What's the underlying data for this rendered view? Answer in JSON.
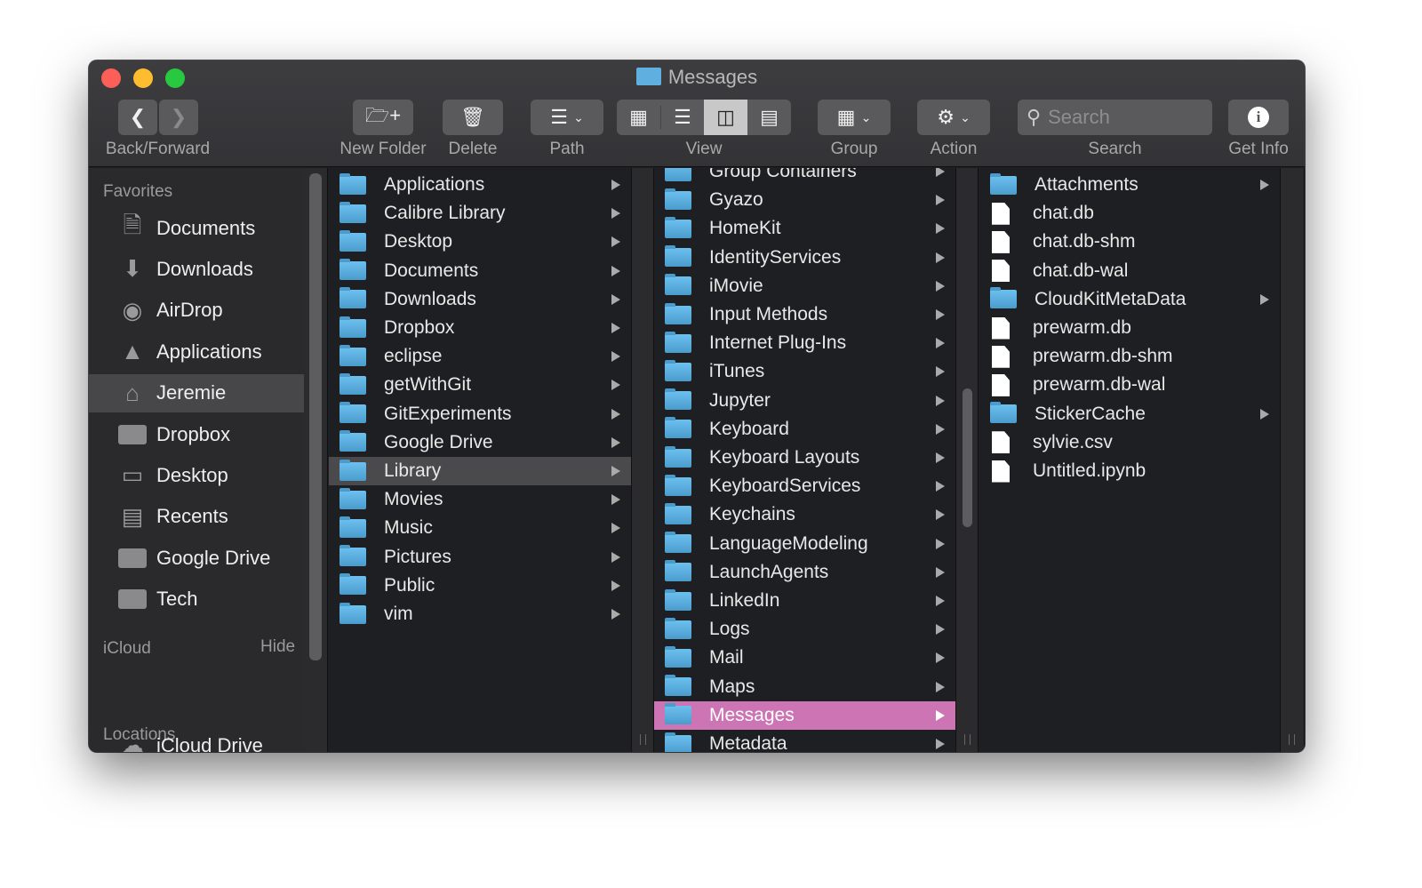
{
  "window": {
    "title": "Messages"
  },
  "toolbar": {
    "back_forward": "Back/Forward",
    "new_folder": "New Folder",
    "delete": "Delete",
    "path": "Path",
    "view": "View",
    "group": "Group",
    "action": "Action",
    "search_label": "Search",
    "search_placeholder": "Search",
    "get_info": "Get Info",
    "active_view": "columns"
  },
  "sidebar": {
    "favorites": "Favorites",
    "items": [
      {
        "label": "Documents",
        "icon": "documents-icon"
      },
      {
        "label": "Downloads",
        "icon": "downloads-icon"
      },
      {
        "label": "AirDrop",
        "icon": "airdrop-icon"
      },
      {
        "label": "Applications",
        "icon": "applications-icon"
      },
      {
        "label": "Jeremie",
        "icon": "home-icon",
        "selected": true
      },
      {
        "label": "Dropbox",
        "icon": "folder-icon"
      },
      {
        "label": "Desktop",
        "icon": "desktop-icon"
      },
      {
        "label": "Recents",
        "icon": "recents-icon"
      },
      {
        "label": "Google Drive",
        "icon": "folder-icon"
      },
      {
        "label": "Tech",
        "icon": "folder-icon"
      }
    ],
    "icloud": "iCloud",
    "hide": "Hide",
    "icloud_items": [
      {
        "label": "iCloud Drive",
        "icon": "cloud-icon"
      }
    ],
    "locations": "Locations"
  },
  "columns": [
    {
      "items": [
        {
          "name": "Applications",
          "type": "folder"
        },
        {
          "name": "Calibre Library",
          "type": "folder"
        },
        {
          "name": "Desktop",
          "type": "folder"
        },
        {
          "name": "Documents",
          "type": "folder"
        },
        {
          "name": "Downloads",
          "type": "folder"
        },
        {
          "name": "Dropbox",
          "type": "folder"
        },
        {
          "name": "eclipse",
          "type": "folder"
        },
        {
          "name": "getWithGit",
          "type": "folder"
        },
        {
          "name": "GitExperiments",
          "type": "folder"
        },
        {
          "name": "Google Drive",
          "type": "folder"
        },
        {
          "name": "Library",
          "type": "folder",
          "selected": "grey"
        },
        {
          "name": "Movies",
          "type": "folder"
        },
        {
          "name": "Music",
          "type": "folder"
        },
        {
          "name": "Pictures",
          "type": "folder"
        },
        {
          "name": "Public",
          "type": "folder"
        },
        {
          "name": "vim",
          "type": "folder"
        }
      ]
    },
    {
      "items": [
        {
          "name": "Group Containers",
          "type": "folder"
        },
        {
          "name": "Gyazo",
          "type": "folder"
        },
        {
          "name": "HomeKit",
          "type": "folder"
        },
        {
          "name": "IdentityServices",
          "type": "folder"
        },
        {
          "name": "iMovie",
          "type": "folder"
        },
        {
          "name": "Input Methods",
          "type": "folder"
        },
        {
          "name": "Internet Plug-Ins",
          "type": "folder"
        },
        {
          "name": "iTunes",
          "type": "folder"
        },
        {
          "name": "Jupyter",
          "type": "folder"
        },
        {
          "name": "Keyboard",
          "type": "folder"
        },
        {
          "name": "Keyboard Layouts",
          "type": "folder"
        },
        {
          "name": "KeyboardServices",
          "type": "folder"
        },
        {
          "name": "Keychains",
          "type": "folder"
        },
        {
          "name": "LanguageModeling",
          "type": "folder"
        },
        {
          "name": "LaunchAgents",
          "type": "folder"
        },
        {
          "name": "LinkedIn",
          "type": "folder"
        },
        {
          "name": "Logs",
          "type": "folder"
        },
        {
          "name": "Mail",
          "type": "folder"
        },
        {
          "name": "Maps",
          "type": "folder"
        },
        {
          "name": "Messages",
          "type": "folder",
          "selected": "pink"
        },
        {
          "name": "Metadata",
          "type": "folder"
        }
      ]
    },
    {
      "items": [
        {
          "name": "Attachments",
          "type": "folder"
        },
        {
          "name": "chat.db",
          "type": "file"
        },
        {
          "name": "chat.db-shm",
          "type": "file"
        },
        {
          "name": "chat.db-wal",
          "type": "file"
        },
        {
          "name": "CloudKitMetaData",
          "type": "folder"
        },
        {
          "name": "prewarm.db",
          "type": "file"
        },
        {
          "name": "prewarm.db-shm",
          "type": "file"
        },
        {
          "name": "prewarm.db-wal",
          "type": "file"
        },
        {
          "name": "StickerCache",
          "type": "folder"
        },
        {
          "name": "sylvie.csv",
          "type": "file"
        },
        {
          "name": "Untitled.ipynb",
          "type": "file"
        }
      ]
    }
  ],
  "colors": {
    "selection_pink": "#cc74b4",
    "folder_blue": "#5fb0e0"
  }
}
